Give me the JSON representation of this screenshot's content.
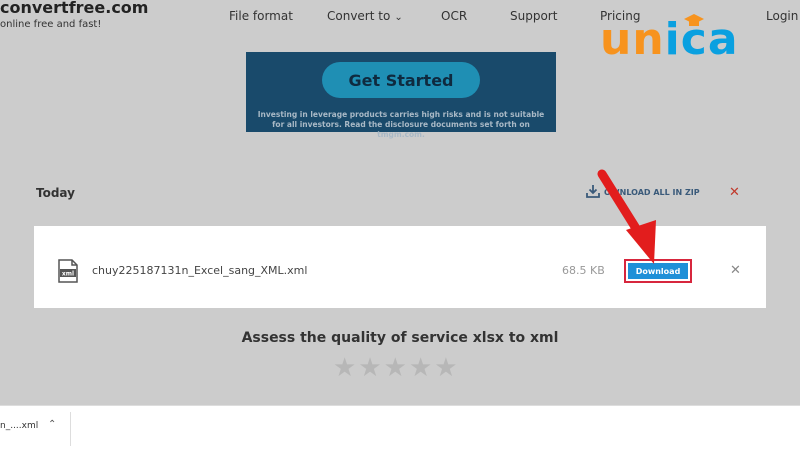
{
  "header": {
    "site_name": "convertfree.com",
    "tagline": "online free and fast!",
    "nav": {
      "file_format": "File format",
      "convert_to": "Convert to",
      "ocr": "OCR",
      "support": "Support",
      "pricing": "Pricing",
      "login": "Login"
    }
  },
  "brand": {
    "letters": [
      "u",
      "n",
      "i",
      "c",
      "a"
    ],
    "colors": {
      "orange": "#f7931e",
      "blue": "#0aa0e0"
    }
  },
  "ad": {
    "cta_label": "Get Started",
    "disclaimer": "Investing in leverage products carries high risks and is not suitable for all investors. Read the disclosure documents set forth on tmgm.com."
  },
  "today": {
    "title": "Today",
    "download_all_label": "OWNLOAD ALL IN ZIP",
    "clear_all_icon": "close-icon"
  },
  "file": {
    "name": "chuy225187131n_Excel_sang_XML.xml",
    "size": "68.5 KB",
    "download_label": "Download",
    "type_icon": "xml-file-icon"
  },
  "rating": {
    "title": "Assess the quality of service xlsx to xml",
    "stars_total": 5,
    "stars_filled": 0
  },
  "downloads_bar": {
    "item_label": "n_....xml"
  },
  "colors": {
    "accent": "#1e90d8",
    "highlight": "#d7263d",
    "backdrop": "#cccccc"
  }
}
